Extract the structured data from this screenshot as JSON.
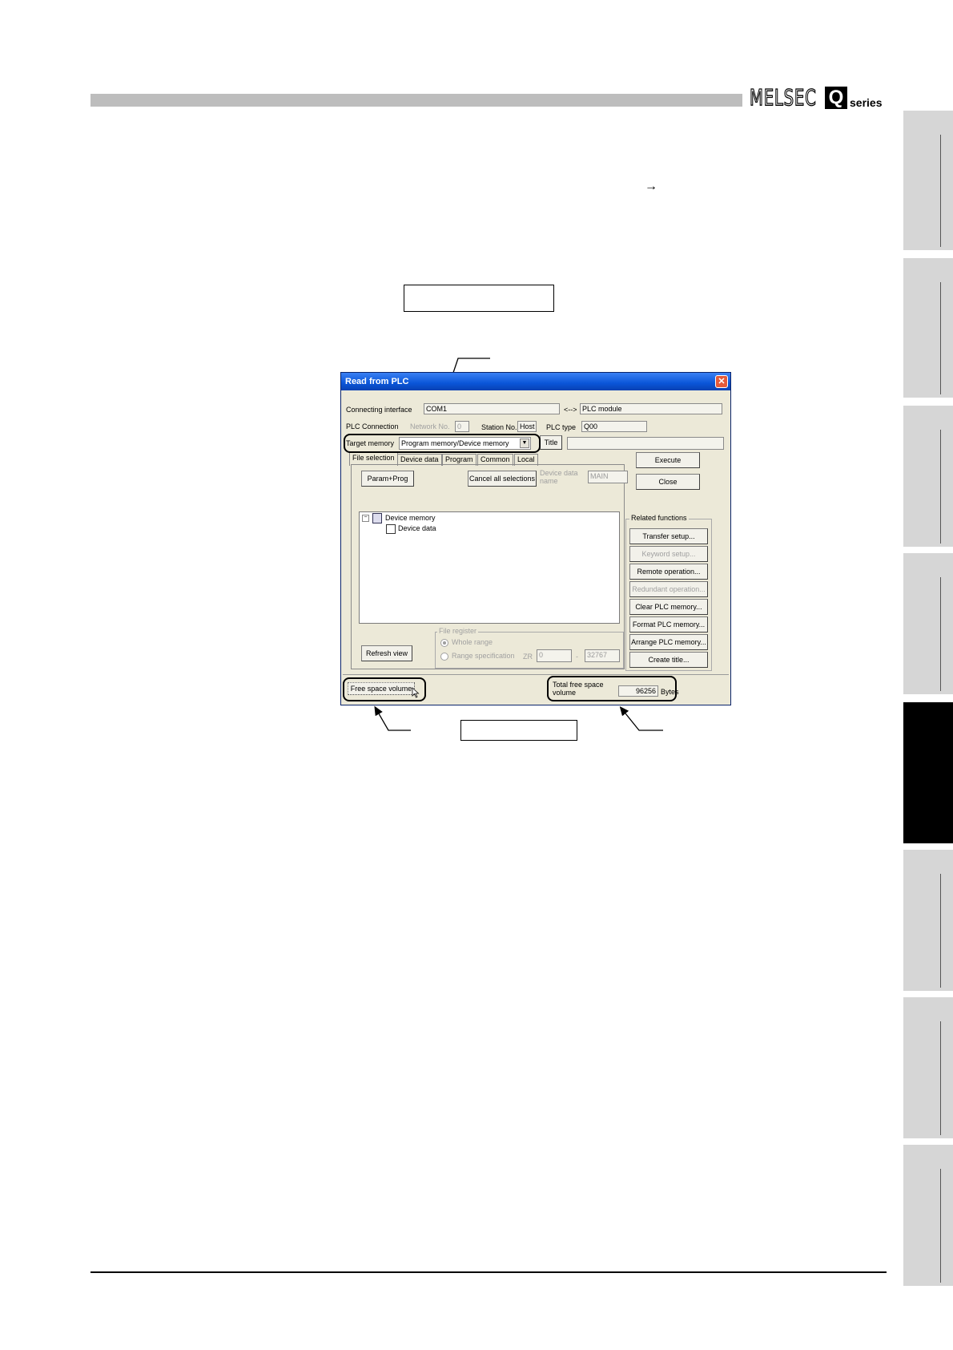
{
  "header": {
    "logo_word": "MELSEC",
    "logo_letter": "Q",
    "logo_series": "series"
  },
  "page": {
    "arrow_glyph": "→"
  },
  "dialog": {
    "title": "Read from PLC",
    "close_glyph": "✕",
    "connecting_interface_label": "Connecting interface",
    "connecting_interface_value": "COM1",
    "link_symbol": "<-->",
    "plc_module_value": "PLC module",
    "plc_connection_label": "PLC Connection",
    "network_no_label": "Network No.",
    "network_no_value": "0",
    "station_no_label": "Station No.",
    "station_no_value": "Host",
    "plc_type_label": "PLC type",
    "plc_type_value": "Q00",
    "target_memory_label": "Target memory",
    "target_memory_value": "Program memory/Device memory",
    "title_button": "Title",
    "tabs": [
      "File selection",
      "Device data",
      "Program",
      "Common",
      "Local"
    ],
    "param_prog_button": "Param+Prog",
    "cancel_all_button": "Cancel all selections",
    "device_data_name_label": "Device data name",
    "device_data_name_value": "MAIN",
    "tree": {
      "root": "Device memory",
      "child": "Device data"
    },
    "execute_button": "Execute",
    "close_button": "Close",
    "related_functions_label": "Related functions",
    "related_buttons": [
      "Transfer setup...",
      "Keyword setup...",
      "Remote operation...",
      "Redundant operation...",
      "Clear PLC memory...",
      "Format PLC memory...",
      "Arrange PLC memory...",
      "Create title..."
    ],
    "refresh_button": "Refresh view",
    "file_register_label": "File register",
    "whole_range_label": "Whole range",
    "range_spec_label": "Range specification",
    "zr_label": "ZR",
    "range_start": "0",
    "range_end": "32767",
    "range_dash": "-",
    "free_space_button": "Free space volume",
    "total_free_label_line1": "Total free space",
    "total_free_label_line2": "volume",
    "total_free_value": "96256",
    "total_free_unit": "Bytes"
  }
}
